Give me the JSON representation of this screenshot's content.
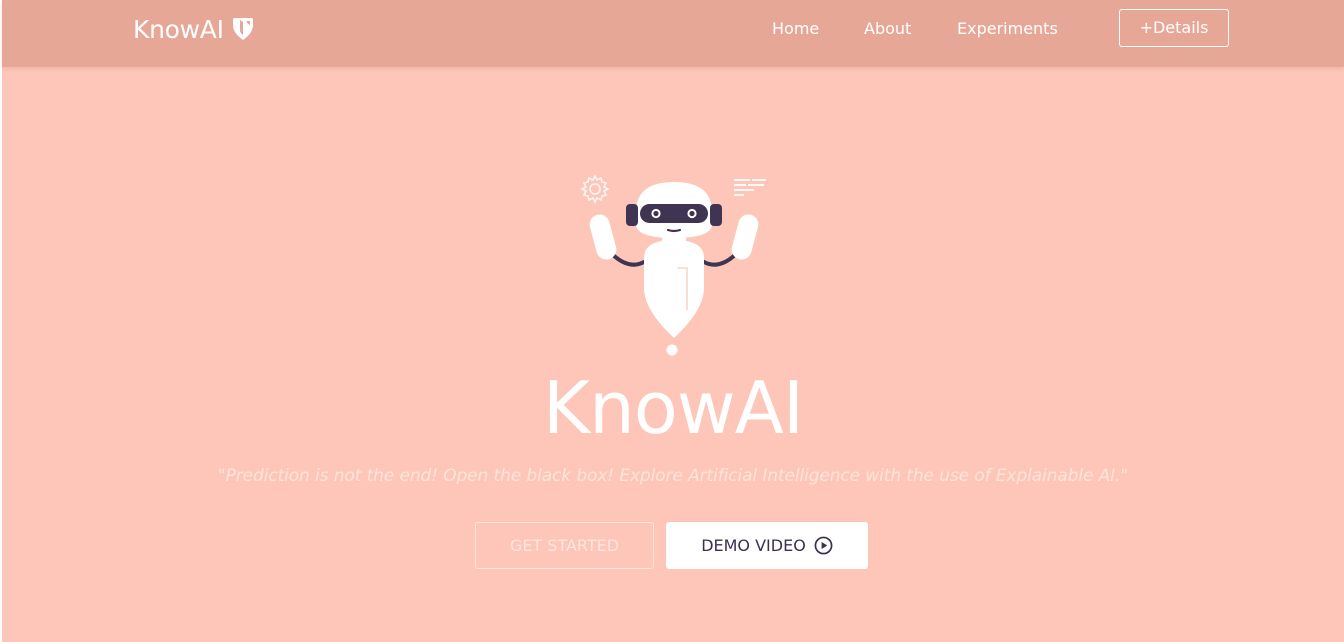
{
  "navbar": {
    "brand": "KnowAI",
    "brand_logo_icon": "shield-icon",
    "links": [
      {
        "label": "Home"
      },
      {
        "label": "About"
      },
      {
        "label": "Experiments"
      }
    ],
    "details_button": "+Details"
  },
  "hero": {
    "illustration_icon": "robot-icon",
    "title": "KnowAI",
    "quote": "\"Prediction is not the end! Open the black box! Explore Artificial Intelligence with the use of Explainable AI.\"",
    "get_started_label": "GET STARTED",
    "demo_video_label": "DEMO VIDEO",
    "demo_video_icon": "play-circle-icon"
  },
  "colors": {
    "background": "#fdc6b8",
    "navbar": "#e6a797",
    "white": "#ffffff",
    "dark_text": "#3c3050",
    "robot_visor": "#3f3552"
  }
}
